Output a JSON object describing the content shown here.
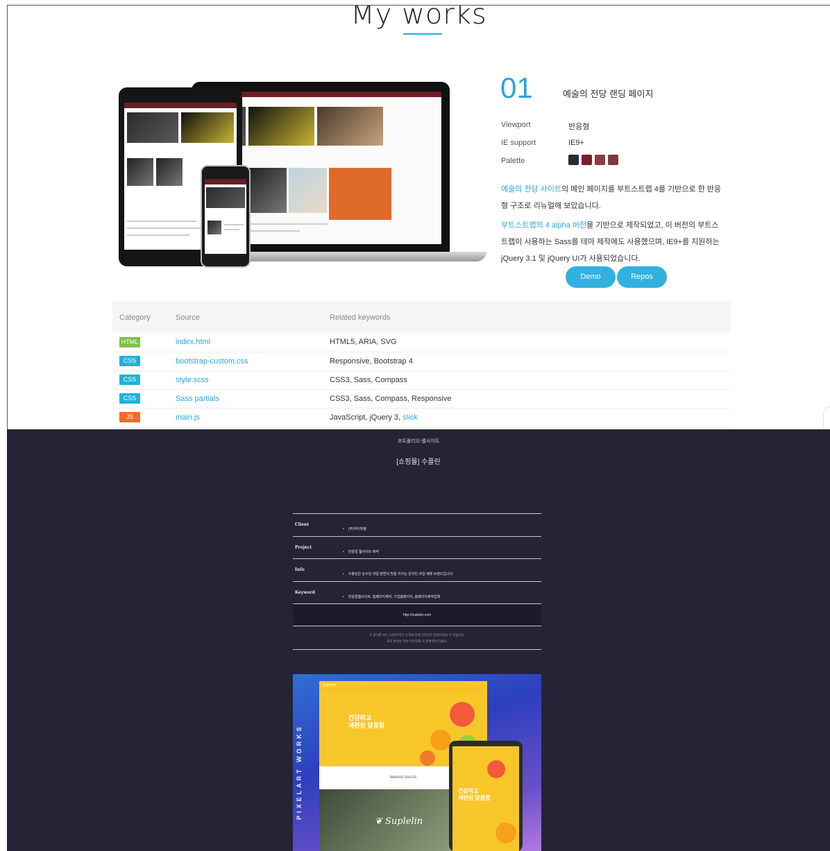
{
  "section": {
    "title": "My works"
  },
  "project": {
    "number": "01",
    "title": "예술의 전당 랜딩 페이지",
    "info": [
      {
        "label": "Viewport",
        "value": "반응형"
      },
      {
        "label": "IE support",
        "value": "IE9+"
      },
      {
        "label": "Palette",
        "value": ""
      }
    ],
    "palette": [
      "#2b2b33",
      "#7a1e2c",
      "#8e3c46",
      "#7b3b3b"
    ],
    "desc1_hl": "예술의 전당 사이트",
    "desc1_rest": "의 메인 페이지를 부트스트랩 4를 기반으로 한 반응형 구조로 리뉴얼해 보았습니다.",
    "desc2_hl": "부트스트랩의 4 alpha 버전",
    "desc2_rest": "을 기반으로 제작되었고, 이 버전의 부트스트랩이 사용하는 Sass를 테마 제작에도 사용했으며, IE9+를 지원하는 jQuery 3.1 및 jQuery UI가 사용되었습니다.",
    "demo_label": "Demo",
    "repos_label": "Repos"
  },
  "files_table": {
    "headers": [
      "Category",
      "Source",
      "Related keywords"
    ],
    "rows": [
      {
        "category": "HTML",
        "color": "#7dc242",
        "source": "index.html",
        "keywords": "HTML5, ARIA, SVG",
        "keyword_link": ""
      },
      {
        "category": "CSS",
        "color": "#1fb3d8",
        "source": "bootstrap-custom.css",
        "keywords": "Responsive, Bootstrap 4",
        "keyword_link": ""
      },
      {
        "category": "CSS",
        "color": "#1fb3d8",
        "source": "style.scss",
        "keywords": "CSS3, Sass, Compass",
        "keyword_link": ""
      },
      {
        "category": "CSS",
        "color": "#1fb3d8",
        "source": "Sass partials",
        "keywords": "CSS3, Sass, Compass, Responsive",
        "keyword_link": ""
      },
      {
        "category": "JS",
        "color": "#f26b21",
        "source": "main.js",
        "keywords": "JavaScript, jQuery 3, ",
        "keyword_link": "slick"
      }
    ]
  },
  "portfolio": {
    "category": "포트폴리오-웹사이트",
    "title": "[쇼핑몰] 수플린",
    "details": [
      {
        "label": "Client",
        "value": "(주)하이퍼블"
      },
      {
        "label": "Project",
        "value": "반응형 웹사이트 제작"
      },
      {
        "label": "Info",
        "value": "수플린은 순수한 과일 본연의 맛을 지키는 온라인 과일 매켓 브랜드입니다."
      },
      {
        "label": "Keyword",
        "value": "반응형웹사이트, 홈페이지제작, 기업홈페이지, 홈페이지제작업체"
      }
    ],
    "site_link": "http://suplelin.com",
    "note_line1": "※ 링크를 보는 시점에 따라 고객에 의해 디자인이 변경되었을 수 있습니다.",
    "note_line2": "최초 완성된 화면 이미지를 꼭 함께 확인하세요."
  },
  "showcase": {
    "vertical_text": "PIXELART WORKS",
    "headline_line1": "건강하고",
    "headline_line2": "세련된 달콤함",
    "brand_value": "BRAND VALUE",
    "logo": "Suplelin"
  }
}
